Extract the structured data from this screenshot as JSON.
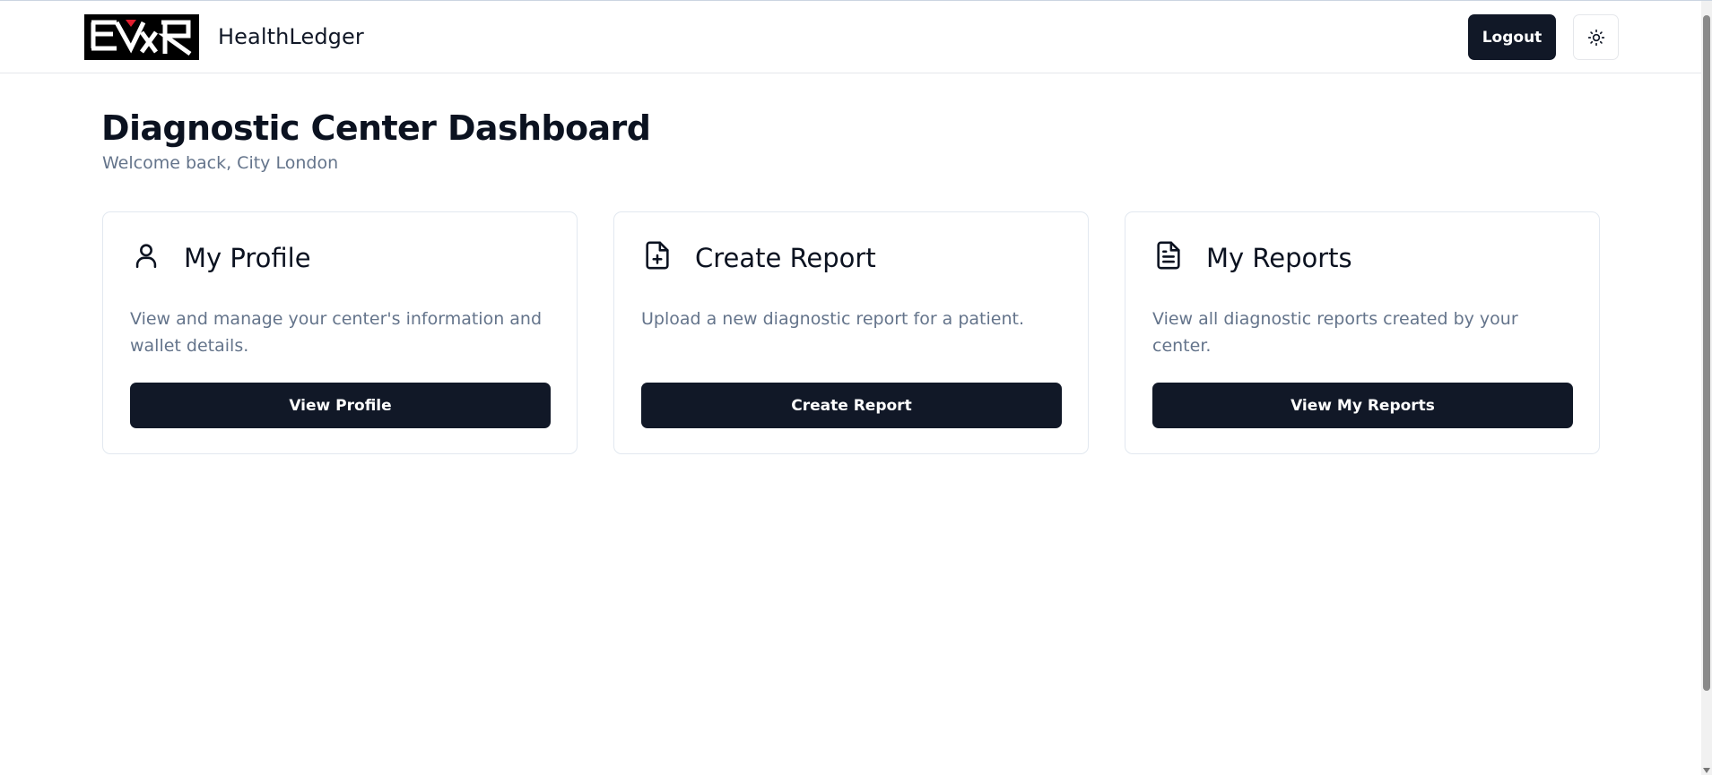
{
  "header": {
    "brand": "HealthLedger",
    "logo_icon": "health-ledger-logo",
    "logout_label": "Logout",
    "theme_icon": "sun-icon"
  },
  "main": {
    "title": "Diagnostic Center Dashboard",
    "subtitle": "Welcome back, City London",
    "cards": [
      {
        "icon": "user-icon",
        "title": "My Profile",
        "description": "View and manage your center's information and wallet details.",
        "button": "View Profile"
      },
      {
        "icon": "file-plus-icon",
        "title": "Create Report",
        "description": "Upload a new diagnostic report for a patient.",
        "button": "Create Report"
      },
      {
        "icon": "file-text-icon",
        "title": "My Reports",
        "description": "View all diagnostic reports created by your center.",
        "button": "View My Reports"
      }
    ]
  },
  "colors": {
    "primary": "#111827",
    "muted_text": "#64748b",
    "border": "#e2e8f0",
    "logo_accent": "#e11d2e"
  }
}
